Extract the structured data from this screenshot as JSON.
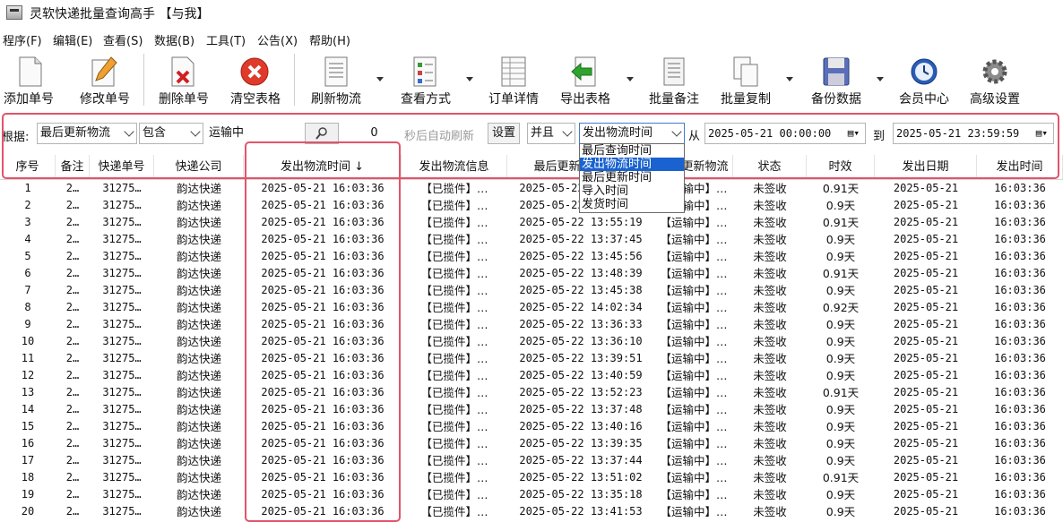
{
  "window": {
    "title": "灵软快递批量查询高手 【与我】"
  },
  "menu": [
    "程序(F)",
    "编辑(E)",
    "查看(S)",
    "数据(B)",
    "工具(T)",
    "公告(X)",
    "帮助(H)"
  ],
  "toolbar": {
    "add": "添加单号",
    "edit": "修改单号",
    "delete": "删除单号",
    "clear": "清空表格",
    "refresh": "刷新物流",
    "view_mode": "查看方式",
    "order_detail": "订单详情",
    "export": "导出表格",
    "batch_note": "批量备注",
    "batch_copy": "批量复制",
    "backup": "备份数据",
    "member": "会员中心",
    "settings": "高级设置"
  },
  "filter": {
    "basis_label": "根据:",
    "basis_value": "最后更新物流",
    "match_value": "包含",
    "keyword": "运输中",
    "refresh_seconds": "0",
    "auto_refresh_label": "秒后自动刷新",
    "set_button": "设置",
    "logic_value": "并且",
    "time_field": "发出物流时间",
    "from_label": "从",
    "from_time": "2025-05-21 00:00:00",
    "to_label": "到",
    "to_time": "2025-05-21 23:59:59"
  },
  "time_field_options": [
    "最后查询时间",
    "发出物流时间",
    "最后更新时间",
    "导入时间",
    "发货时间"
  ],
  "time_field_selected_index": 1,
  "columns": [
    "序号",
    "备注",
    "快递单号",
    "快递公司",
    "发出物流时间 ↓",
    "发出物流信息",
    "最后更新物流时间",
    "最后更新物流",
    "状态",
    "时效",
    "发出日期",
    "发出时间"
  ],
  "rows": [
    [
      "1",
      "2…",
      "31275…",
      "韵达快递",
      "2025-05-21 16:03:36",
      "【已揽件】…",
      "2025-05-22 13:37:45",
      "【运输中】…",
      "未签收",
      "0.91天",
      "2025-05-21",
      "16:03:36"
    ],
    [
      "2",
      "2…",
      "31275…",
      "韵达快递",
      "2025-05-21 16:03:36",
      "【已揽件】…",
      "2025-05-22 13:40:40",
      "【运输中】…",
      "未签收",
      "0.9天",
      "2025-05-21",
      "16:03:36"
    ],
    [
      "3",
      "2…",
      "31275…",
      "韵达快递",
      "2025-05-21 16:03:36",
      "【已揽件】…",
      "2025-05-22 13:55:19",
      "【运输中】…",
      "未签收",
      "0.91天",
      "2025-05-21",
      "16:03:36"
    ],
    [
      "4",
      "2…",
      "31275…",
      "韵达快递",
      "2025-05-21 16:03:36",
      "【已揽件】…",
      "2025-05-22 13:37:45",
      "【运输中】…",
      "未签收",
      "0.9天",
      "2025-05-21",
      "16:03:36"
    ],
    [
      "5",
      "2…",
      "31275…",
      "韵达快递",
      "2025-05-21 16:03:36",
      "【已揽件】…",
      "2025-05-22 13:45:56",
      "【运输中】…",
      "未签收",
      "0.9天",
      "2025-05-21",
      "16:03:36"
    ],
    [
      "6",
      "2…",
      "31275…",
      "韵达快递",
      "2025-05-21 16:03:36",
      "【已揽件】…",
      "2025-05-22 13:48:39",
      "【运输中】…",
      "未签收",
      "0.91天",
      "2025-05-21",
      "16:03:36"
    ],
    [
      "7",
      "2…",
      "31275…",
      "韵达快递",
      "2025-05-21 16:03:36",
      "【已揽件】…",
      "2025-05-22 13:45:38",
      "【运输中】…",
      "未签收",
      "0.9天",
      "2025-05-21",
      "16:03:36"
    ],
    [
      "8",
      "2…",
      "31275…",
      "韵达快递",
      "2025-05-21 16:03:36",
      "【已揽件】…",
      "2025-05-22 14:02:34",
      "【运输中】…",
      "未签收",
      "0.92天",
      "2025-05-21",
      "16:03:36"
    ],
    [
      "9",
      "2…",
      "31275…",
      "韵达快递",
      "2025-05-21 16:03:36",
      "【已揽件】…",
      "2025-05-22 13:36:33",
      "【运输中】…",
      "未签收",
      "0.9天",
      "2025-05-21",
      "16:03:36"
    ],
    [
      "10",
      "2…",
      "31275…",
      "韵达快递",
      "2025-05-21 16:03:36",
      "【已揽件】…",
      "2025-05-22 13:36:10",
      "【运输中】…",
      "未签收",
      "0.9天",
      "2025-05-21",
      "16:03:36"
    ],
    [
      "11",
      "2…",
      "31275…",
      "韵达快递",
      "2025-05-21 16:03:36",
      "【已揽件】…",
      "2025-05-22 13:39:51",
      "【运输中】…",
      "未签收",
      "0.9天",
      "2025-05-21",
      "16:03:36"
    ],
    [
      "12",
      "2…",
      "31275…",
      "韵达快递",
      "2025-05-21 16:03:36",
      "【已揽件】…",
      "2025-05-22 13:40:59",
      "【运输中】…",
      "未签收",
      "0.9天",
      "2025-05-21",
      "16:03:36"
    ],
    [
      "13",
      "2…",
      "31275…",
      "韵达快递",
      "2025-05-21 16:03:36",
      "【已揽件】…",
      "2025-05-22 13:52:23",
      "【运输中】…",
      "未签收",
      "0.91天",
      "2025-05-21",
      "16:03:36"
    ],
    [
      "14",
      "2…",
      "31275…",
      "韵达快递",
      "2025-05-21 16:03:36",
      "【已揽件】…",
      "2025-05-22 13:37:48",
      "【运输中】…",
      "未签收",
      "0.9天",
      "2025-05-21",
      "16:03:36"
    ],
    [
      "15",
      "2…",
      "31275…",
      "韵达快递",
      "2025-05-21 16:03:36",
      "【已揽件】…",
      "2025-05-22 13:40:16",
      "【运输中】…",
      "未签收",
      "0.9天",
      "2025-05-21",
      "16:03:36"
    ],
    [
      "16",
      "2…",
      "31275…",
      "韵达快递",
      "2025-05-21 16:03:36",
      "【已揽件】…",
      "2025-05-22 13:39:35",
      "【运输中】…",
      "未签收",
      "0.9天",
      "2025-05-21",
      "16:03:36"
    ],
    [
      "17",
      "2…",
      "31275…",
      "韵达快递",
      "2025-05-21 16:03:36",
      "【已揽件】…",
      "2025-05-22 13:37:44",
      "【运输中】…",
      "未签收",
      "0.9天",
      "2025-05-21",
      "16:03:36"
    ],
    [
      "18",
      "2…",
      "31275…",
      "韵达快递",
      "2025-05-21 16:03:36",
      "【已揽件】…",
      "2025-05-22 13:51:02",
      "【运输中】…",
      "未签收",
      "0.91天",
      "2025-05-21",
      "16:03:36"
    ],
    [
      "19",
      "2…",
      "31275…",
      "韵达快递",
      "2025-05-21 16:03:36",
      "【已揽件】…",
      "2025-05-22 13:35:18",
      "【运输中】…",
      "未签收",
      "0.9天",
      "2025-05-21",
      "16:03:36"
    ],
    [
      "20",
      "2…",
      "31275…",
      "韵达快递",
      "2025-05-21 16:03:36",
      "【已揽件】…",
      "2025-05-22 13:41:53",
      "【运输中】…",
      "未签收",
      "0.9天",
      "2025-05-21",
      "16:03:36"
    ]
  ]
}
